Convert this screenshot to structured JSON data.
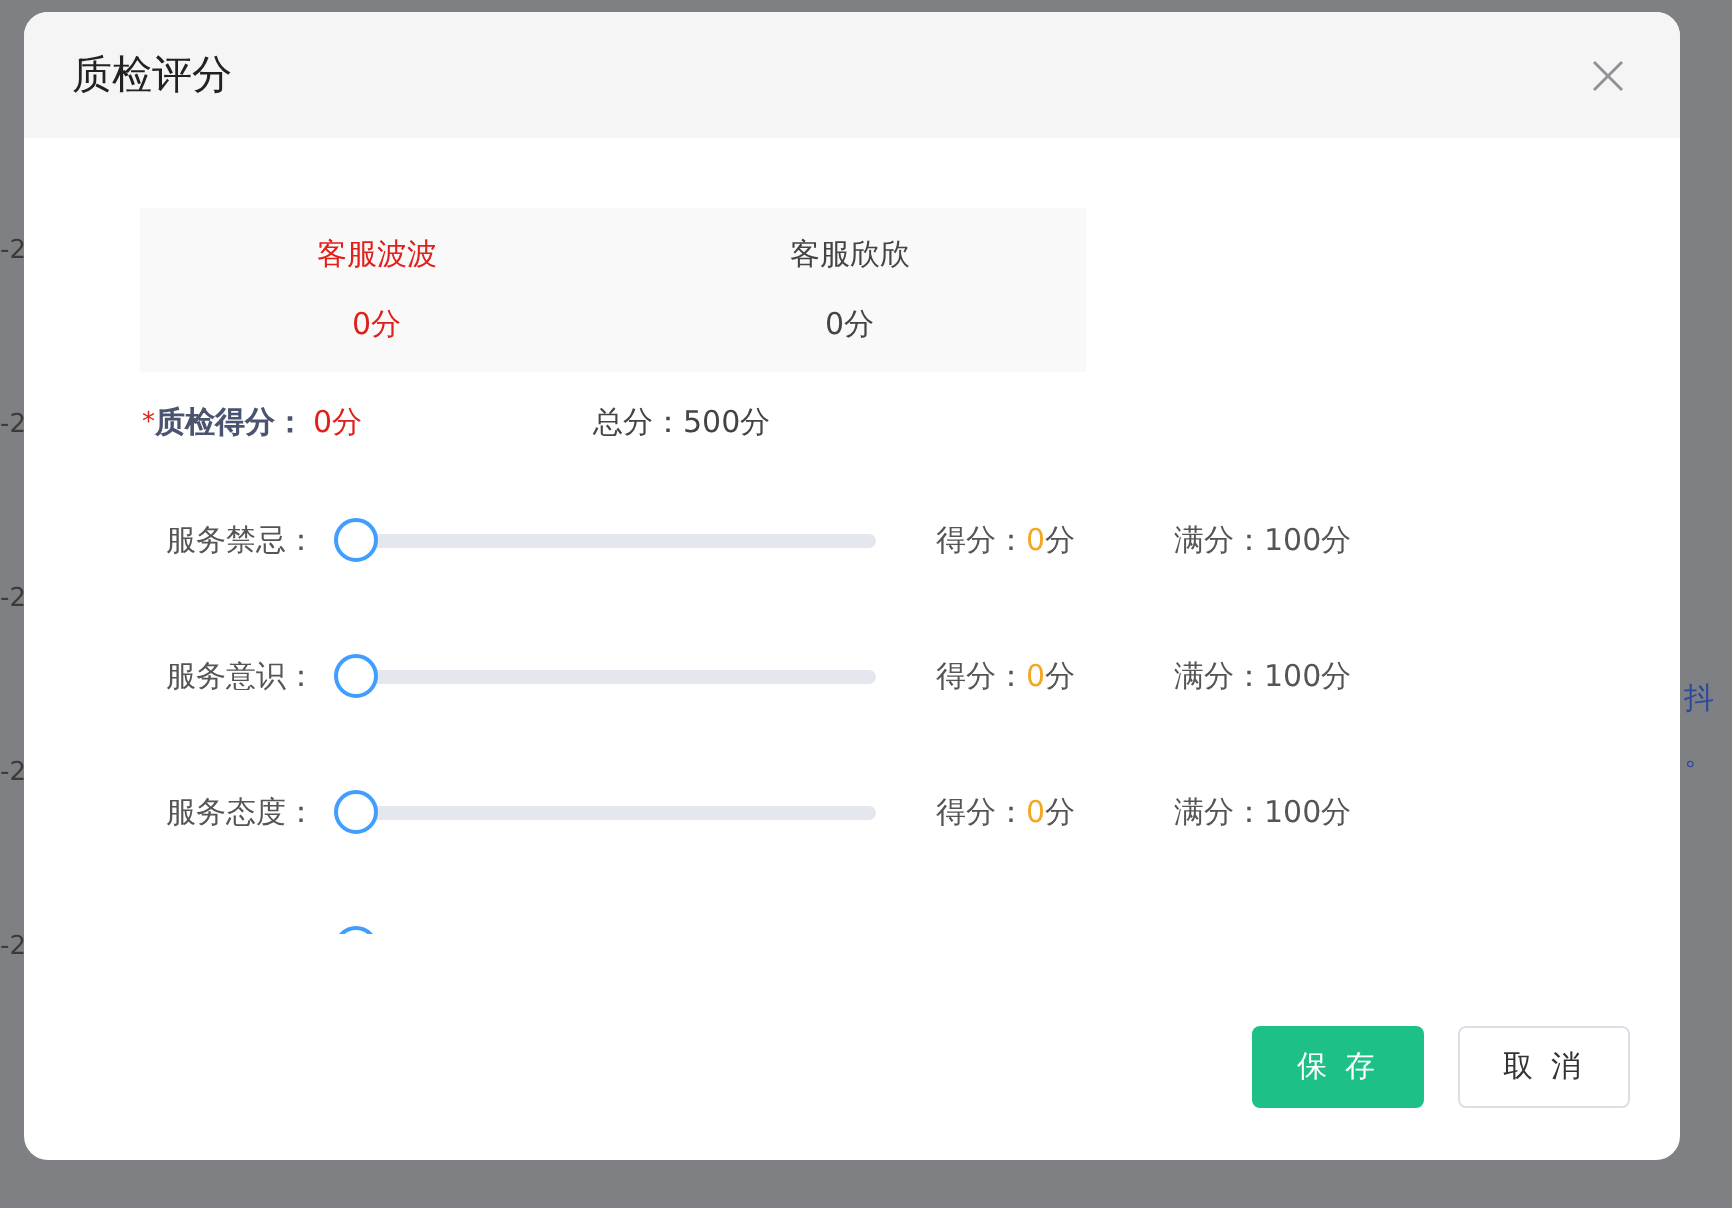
{
  "background": {
    "left_fragments": [
      "-2",
      "-2",
      "-2",
      "-2",
      "-2"
    ],
    "right_fragments": [
      "抖",
      "。"
    ]
  },
  "dialog": {
    "title": "质检评分",
    "agents": [
      {
        "name": "客服波波",
        "score": "0分",
        "selected": true
      },
      {
        "name": "客服欣欣",
        "score": "0分",
        "selected": false
      }
    ],
    "total_line": {
      "required_mark": "*",
      "label": "质检得分：",
      "value": "0分",
      "total": "总分：500分"
    },
    "criteria": [
      {
        "label": "服务禁忌：",
        "level": 0,
        "score_label": "得分：",
        "score": "0",
        "score_unit": "分",
        "max": "满分：100分"
      },
      {
        "label": "服务意识：",
        "level": 0,
        "score_label": "得分：",
        "score": "0",
        "score_unit": "分",
        "max": "满分：100分"
      },
      {
        "label": "服务态度：",
        "level": 0,
        "score_label": "得分：",
        "score": "0",
        "score_unit": "分",
        "max": "满分：100分"
      },
      {
        "level": 0
      }
    ],
    "buttons": [
      {
        "label": "保 存",
        "kind": "primary"
      },
      {
        "label": "取 消",
        "kind": "secondary"
      }
    ]
  }
}
